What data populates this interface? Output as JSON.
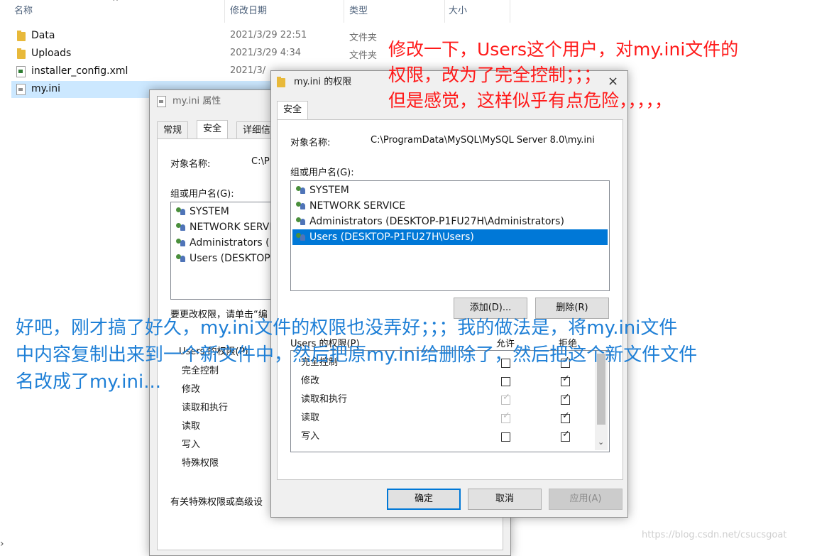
{
  "explorer": {
    "columns": {
      "name": "名称",
      "modified": "修改日期",
      "type": "类型",
      "size": "大小"
    },
    "files": [
      {
        "name": "Data",
        "date": "2021/3/29 22:51",
        "type": "文件夹",
        "icon": "folder-icon"
      },
      {
        "name": "Uploads",
        "date": "2021/3/29 4:34",
        "type": "文件夹",
        "icon": "folder-icon"
      },
      {
        "name": "installer_config.xml",
        "date": "2021/3/",
        "type": "",
        "icon": "xml-file-icon"
      },
      {
        "name": "my.ini",
        "date": "",
        "type": "",
        "icon": "ini-file-icon"
      }
    ]
  },
  "props_dialog": {
    "title": "my.ini 属性",
    "tabs": [
      "常规",
      "安全",
      "详细信"
    ],
    "object_label": "对象名称:",
    "object_value": "C:\\P",
    "group_label": "组或用户名(G):",
    "users": [
      "SYSTEM",
      "NETWORK SERVIC",
      "Administrators (D",
      "Users (DESKTOP-"
    ],
    "change_hint": "要更改权限，请单击“编",
    "perm_header": "Users 的权限(P)",
    "perms": [
      "完全控制",
      "修改",
      "读取和执行",
      "读取",
      "写入",
      "特殊权限"
    ],
    "footer_hint": "有关特殊权限或高级设"
  },
  "perm_dialog": {
    "title": "my.ini 的权限",
    "close_glyph": "×",
    "tab": "安全",
    "object_label": "对象名称:",
    "object_value": "C:\\ProgramData\\MySQL\\MySQL Server 8.0\\my.ini",
    "group_label": "组或用户名(G):",
    "users": [
      "SYSTEM",
      "NETWORK SERVICE",
      "Administrators (DESKTOP-P1FU27H\\Administrators)",
      "Users (DESKTOP-P1FU27H\\Users)"
    ],
    "add_button": "添加(D)...",
    "remove_button": "删除(R)",
    "perm_header": "Users 的权限(P)",
    "allow_header": "允许",
    "deny_header": "拒绝",
    "perms": [
      "完全控制",
      "修改",
      "读取和执行",
      "读取",
      "写入"
    ],
    "ok_button": "确定",
    "cancel_button": "取消",
    "apply_button": "应用(A)"
  },
  "annotations": {
    "red_lines": [
      "修改一下，Users这个用户，对my.ini文件的",
      "权限，改为了完全控制；；；",
      "但是感觉，这样似乎有点危险，，，，，"
    ],
    "blue_lines": [
      "好吧，刚才搞了好久，my.ini文件的权限也没弄好；；；我的做法是，将my.ini文件",
      "中内容复制出来到一个新文件中，然后把原my.ini给删除了，然后把这个新文件文件",
      "名改成了my.ini..."
    ],
    "watermark": "https://blog.csdn.net/csucsgoat"
  },
  "colors": {
    "selection": "#0078d7",
    "annotation_red": "#ff1a1a",
    "annotation_blue": "#1e7fd6"
  }
}
